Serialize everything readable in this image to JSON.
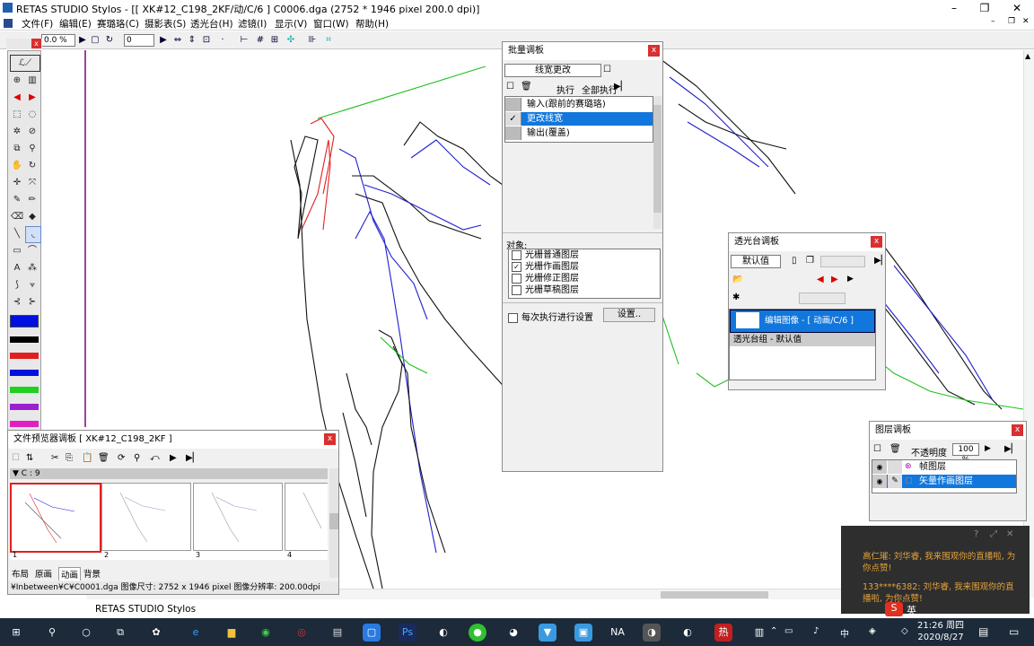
{
  "window": {
    "title": "RETAS STUDIO Stylos - [[ XK#12_C198_2KF/动/C/6 ] C0006.dga (2752 * 1946 pixel 200.0 dpi)]"
  },
  "menu": [
    "文件(F)",
    "编辑(E)",
    "赛璐珞(C)",
    "摄影表(S)",
    "透光台(H)",
    "滤镜(I)",
    "显示(V)",
    "窗口(W)",
    "帮助(H)"
  ],
  "toolbar": {
    "zoom": "0.0 %",
    "angle": "0"
  },
  "batch": {
    "title": "批量调板",
    "preset": "线宽更改",
    "exec": "执行",
    "exec_all": "全部执行",
    "steps": [
      {
        "label": "输入(跟前的赛璐珞)",
        "checked": false,
        "selected": false
      },
      {
        "label": "更改线宽",
        "checked": true,
        "selected": true
      },
      {
        "label": "输出(覆盖)",
        "checked": false,
        "selected": false
      }
    ],
    "target_label": "对象:",
    "targets": [
      {
        "label": "光栅普通图层",
        "checked": false
      },
      {
        "label": "光栅作画图层",
        "checked": true
      },
      {
        "label": "光栅修正图层",
        "checked": false
      },
      {
        "label": "光栅草稿图层",
        "checked": false
      }
    ],
    "each_setting": "每次执行进行设置",
    "settings_btn": "设置.."
  },
  "lightbox": {
    "title": "透光台调板",
    "preset": "默认值",
    "item": "编辑图像 - [ 动画/C/6 ] C0...",
    "group": "透光台组 - 默认值"
  },
  "layers": {
    "title": "图层调板",
    "opacity_label": "不透明度",
    "opacity": "100 %",
    "items": [
      {
        "label": "帧图层",
        "selected": false
      },
      {
        "label": "矢量作画图层",
        "selected": true
      }
    ]
  },
  "browser": {
    "title": "文件预览器调板 [ XK#12_C198_2KF ]",
    "folder": "C : 9",
    "thumbs": [
      "1",
      "2",
      "3",
      "4"
    ],
    "tabs": [
      "布局",
      "原画",
      "动画",
      "背景"
    ],
    "status": "¥Inbetween¥C¥C0001.dga  图像尺寸: 2752 x 1946 pixel  图像分辨率: 200.00dpi"
  },
  "app_label": "RETAS STUDIO Stylos",
  "chat": {
    "lines": [
      "高仁璀: 刘华睿, 我来围观你的直播啦, 为你点赞!",
      "133****6382: 刘华睿, 我来围观你的直播啦, 为你点赞!"
    ]
  },
  "tray": {
    "ime": "英",
    "time": "21:26 周四",
    "date": "2020/8/27"
  },
  "colors": {
    "accent": "#1177dd",
    "line_red": "#e02020",
    "line_blue": "#2020d0",
    "line_green": "#20c020"
  }
}
